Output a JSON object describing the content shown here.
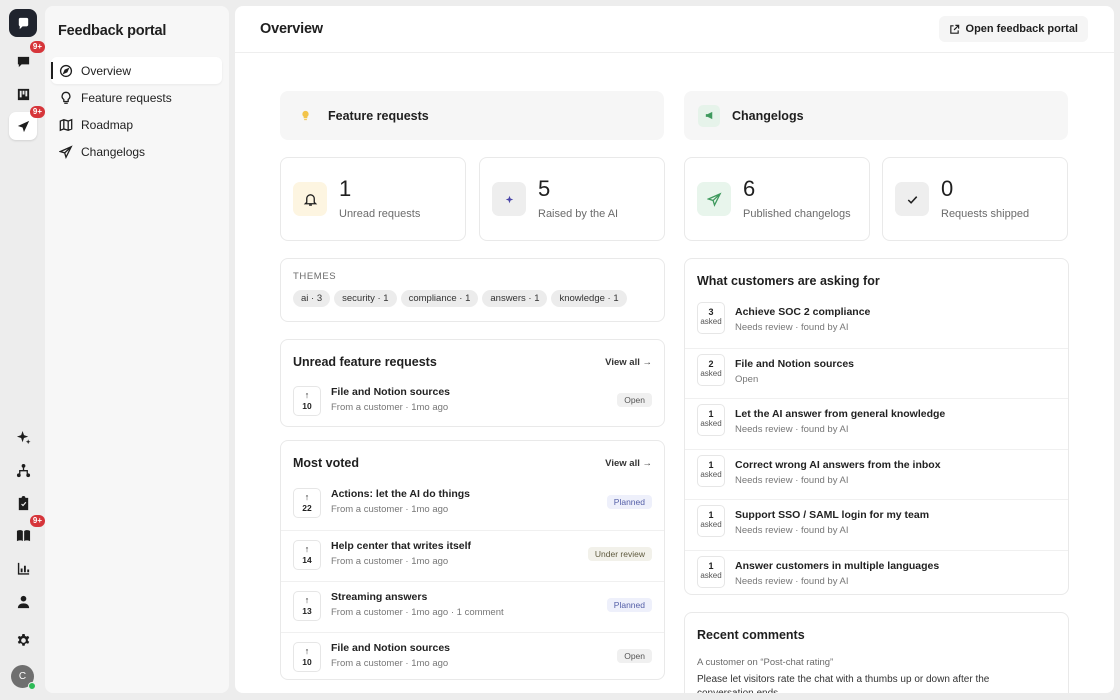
{
  "rail": {
    "badges": {
      "inbox": "9+",
      "outbound": "9+",
      "knowledge": "9+"
    },
    "avatar_initial": "C"
  },
  "nav": {
    "title": "Feedback portal",
    "items": [
      {
        "label": "Overview",
        "icon": "compass-icon"
      },
      {
        "label": "Feature requests",
        "icon": "lightbulb-icon"
      },
      {
        "label": "Roadmap",
        "icon": "map-icon"
      },
      {
        "label": "Changelogs",
        "icon": "megaphone-icon"
      }
    ]
  },
  "header": {
    "title": "Overview",
    "open_portal_label": "Open feedback portal"
  },
  "sections": {
    "feature_requests": "Feature requests",
    "changelogs": "Changelogs"
  },
  "stats": [
    {
      "value": "1",
      "label": "Unread requests",
      "icon": "bell-icon"
    },
    {
      "value": "5",
      "label": "Raised by the AI",
      "icon": "sparkle-icon"
    },
    {
      "value": "6",
      "label": "Published changelogs",
      "icon": "megaphone-icon"
    },
    {
      "value": "0",
      "label": "Requests shipped",
      "icon": "check-icon"
    }
  ],
  "themes": {
    "label": "THEMES",
    "chips": [
      "ai · 3",
      "security · 1",
      "compliance · 1",
      "answers · 1",
      "knowledge · 1"
    ]
  },
  "unread": {
    "title": "Unread feature requests",
    "view_all": "View all →",
    "rows": [
      {
        "votes": "10",
        "title": "File and Notion sources",
        "meta": "From a customer · 1mo ago",
        "status": "Open"
      }
    ]
  },
  "most_voted": {
    "title": "Most voted",
    "view_all": "View all →",
    "rows": [
      {
        "votes": "22",
        "title": "Actions: let the AI do things",
        "meta": "From a customer · 1mo ago",
        "status": "Planned"
      },
      {
        "votes": "14",
        "title": "Help center that writes itself",
        "meta": "From a customer · 1mo ago",
        "status": "Under review"
      },
      {
        "votes": "13",
        "title": "Streaming answers",
        "meta": "From a customer · 1mo ago · 1 comment",
        "status": "Planned"
      },
      {
        "votes": "10",
        "title": "File and Notion sources",
        "meta": "From a customer · 1mo ago",
        "status": "Open"
      }
    ]
  },
  "asking": {
    "title": "What customers are asking for",
    "asked_label": "asked",
    "rows": [
      {
        "count": "3",
        "title": "Achieve SOC 2 compliance",
        "meta": "Needs review · found by AI"
      },
      {
        "count": "2",
        "title": "File and Notion sources",
        "meta": "Open"
      },
      {
        "count": "1",
        "title": "Let the AI answer from general knowledge",
        "meta": "Needs review · found by AI"
      },
      {
        "count": "1",
        "title": "Correct wrong AI answers from the inbox",
        "meta": "Needs review · found by AI"
      },
      {
        "count": "1",
        "title": "Support SSO / SAML login for my team",
        "meta": "Needs review · found by AI"
      },
      {
        "count": "1",
        "title": "Answer customers in multiple languages",
        "meta": "Needs review · found by AI"
      }
    ]
  },
  "recent_comments": {
    "title": "Recent comments",
    "meta": "A customer on “Post-chat rating”",
    "text": "Please let visitors rate the chat with a thumbs up or down after the conversation ends"
  }
}
